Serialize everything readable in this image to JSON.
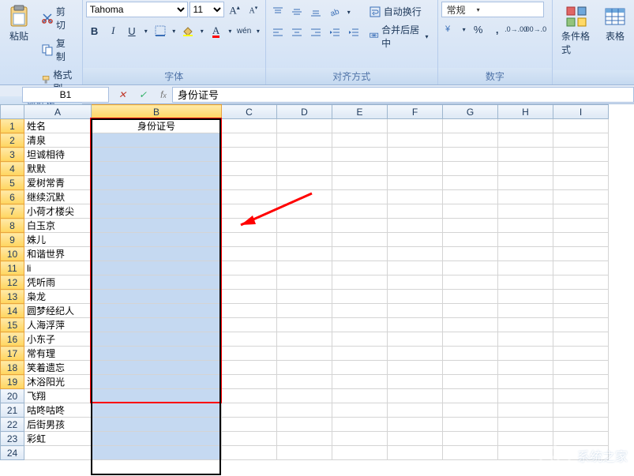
{
  "ribbon": {
    "clipboard": {
      "cut": "剪切",
      "copy": "复制",
      "paste": "粘贴",
      "format_painter": "格式刷",
      "group": "剪贴板"
    },
    "font": {
      "name": "Tahoma",
      "size": "11",
      "group": "字体"
    },
    "align": {
      "wrap": "自动换行",
      "merge": "合并后居中",
      "group": "对齐方式"
    },
    "number": {
      "format": "常规",
      "group": "数字"
    },
    "styles": {
      "cond_fmt": "条件格式",
      "table_fmt": "表格"
    }
  },
  "namebox": "B1",
  "formula": "身份证号",
  "columns": [
    "A",
    "B",
    "C",
    "D",
    "E",
    "F",
    "G",
    "H",
    "I"
  ],
  "rows": [
    {
      "n": 1,
      "a": "姓名",
      "b": "身份证号"
    },
    {
      "n": 2,
      "a": "清泉",
      "b": ""
    },
    {
      "n": 3,
      "a": "坦诚相待",
      "b": ""
    },
    {
      "n": 4,
      "a": "默默",
      "b": ""
    },
    {
      "n": 5,
      "a": "爱树常青",
      "b": ""
    },
    {
      "n": 6,
      "a": "继续沉默",
      "b": ""
    },
    {
      "n": 7,
      "a": "小荷才楼尖",
      "b": ""
    },
    {
      "n": 8,
      "a": "白玉京",
      "b": ""
    },
    {
      "n": 9,
      "a": "姝儿",
      "b": ""
    },
    {
      "n": 10,
      "a": "和谐世界",
      "b": ""
    },
    {
      "n": 11,
      "a": "li",
      "b": ""
    },
    {
      "n": 12,
      "a": "凭听雨",
      "b": ""
    },
    {
      "n": 13,
      "a": "枭龙",
      "b": ""
    },
    {
      "n": 14,
      "a": "圆梦经纪人",
      "b": ""
    },
    {
      "n": 15,
      "a": "人海浮萍",
      "b": ""
    },
    {
      "n": 16,
      "a": "小东子",
      "b": ""
    },
    {
      "n": 17,
      "a": "常有理",
      "b": ""
    },
    {
      "n": 18,
      "a": "笑着遗忘",
      "b": ""
    },
    {
      "n": 19,
      "a": "沐浴阳光",
      "b": ""
    },
    {
      "n": 20,
      "a": "飞翔",
      "b": ""
    },
    {
      "n": 21,
      "a": "咕咚咕咚",
      "b": ""
    },
    {
      "n": 22,
      "a": "后街男孩",
      "b": ""
    },
    {
      "n": 23,
      "a": "彩虹",
      "b": ""
    },
    {
      "n": 24,
      "a": "",
      "b": ""
    }
  ],
  "watermark": "系统之家"
}
